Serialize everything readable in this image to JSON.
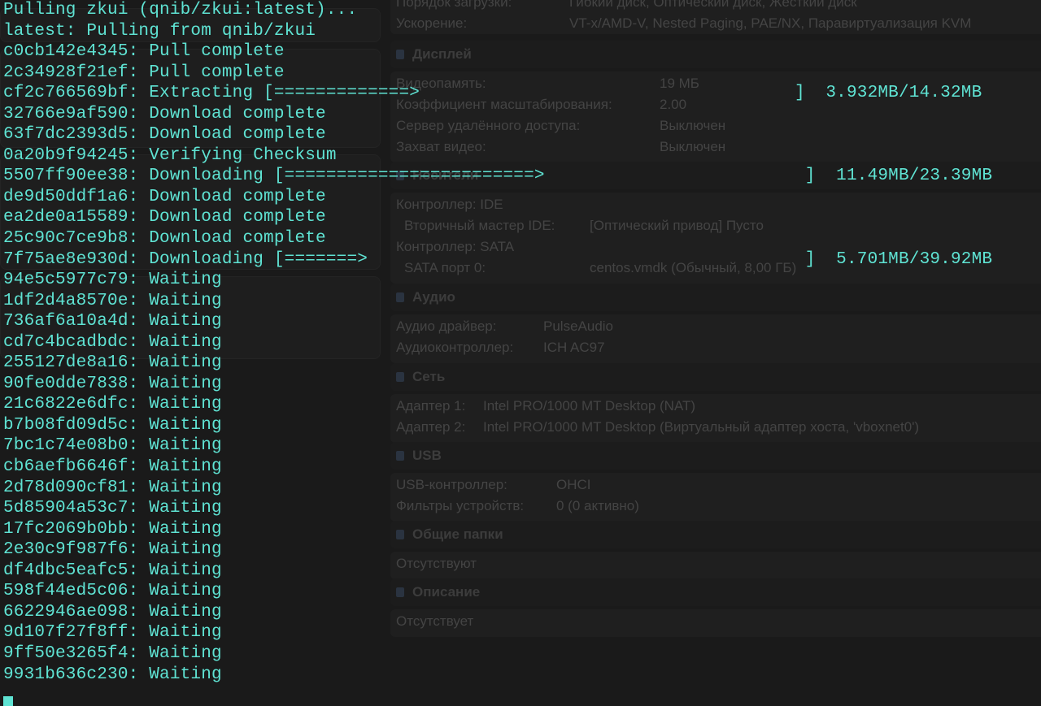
{
  "vbox_details": {
    "top_rows": [
      {
        "label": "Порядок загрузки:",
        "value": "Гибкий диск, Оптический диск, Жесткий диск"
      },
      {
        "label": "Ускорение:",
        "value": "VT-x/AMD-V, Nested Paging, PAE/NX, Паравиртуализация KVM"
      }
    ],
    "sections": [
      {
        "title": "Дисплей",
        "icon": "display-icon",
        "rows": [
          {
            "label": "Видеопамять:",
            "value": "19 МБ"
          },
          {
            "label": "Коэффициент масштабирования:",
            "value": "2.00"
          },
          {
            "label": "Сервер удалённого доступа:",
            "value": "Выключен"
          },
          {
            "label": "Захват видео:",
            "value": "Выключен"
          }
        ]
      },
      {
        "title": "Носители",
        "icon": "storage-icon",
        "rows": [
          {
            "label": "Контроллер: IDE",
            "value": ""
          },
          {
            "label": "Вторичный мастер IDE:",
            "value": "[Оптический привод] Пусто"
          },
          {
            "label": "Контроллер: SATA",
            "value": ""
          },
          {
            "label": "SATA порт 0:",
            "value": "centos.vmdk (Обычный, 8,00 ГБ)"
          }
        ]
      },
      {
        "title": "Аудио",
        "icon": "audio-icon",
        "rows": [
          {
            "label": "Аудио драйвер:",
            "value": "PulseAudio"
          },
          {
            "label": "Аудиоконтроллер:",
            "value": "ICH AC97"
          }
        ]
      },
      {
        "title": "Сеть",
        "icon": "network-icon",
        "rows": [
          {
            "label": "Адаптер 1:",
            "value": "Intel PRO/1000 MT Desktop (NAT)"
          },
          {
            "label": "Адаптер 2:",
            "value": "Intel PRO/1000 MT Desktop (Виртуальный адаптер хоста, 'vboxnet0')"
          }
        ]
      },
      {
        "title": "USB",
        "icon": "usb-icon",
        "rows": [
          {
            "label": "USB-контроллер:",
            "value": "OHCI"
          },
          {
            "label": "Фильтры устройств:",
            "value": "0 (0 активно)"
          }
        ]
      },
      {
        "title": "Общие папки",
        "icon": "shared-folder-icon",
        "rows": [
          {
            "label": "Отсутствуют",
            "value": ""
          }
        ]
      },
      {
        "title": "Описание",
        "icon": "description-icon",
        "rows": [
          {
            "label": "Отсутствует",
            "value": ""
          }
        ]
      }
    ]
  },
  "terminal": {
    "lines": [
      "Pulling zkui (qnib/zkui:latest)...",
      "latest: Pulling from qnib/zkui",
      "c0cb142e4345: Pull complete",
      "2c34928f21ef: Pull complete",
      "cf2c766569bf: Extracting [=============>                                    ]  3.932MB/14.32MB",
      "32766e9af590: Download complete",
      "63f7dc2393d5: Download complete",
      "0a20b9f94245: Verifying Checksum",
      "5507ff90ee38: Downloading [========================>                         ]  11.49MB/23.39MB",
      "de9d50ddf1a6: Download complete",
      "ea2de0a15589: Download complete",
      "25c90c7ce9b8: Download complete",
      "7f75ae8e930d: Downloading [=======>                                          ]  5.701MB/39.92MB",
      "94e5c5977c79: Waiting",
      "1df2d4a8570e: Waiting",
      "736af6a10a4d: Waiting",
      "cd7c4bcadbdc: Waiting",
      "255127de8a16: Waiting",
      "90fe0dde7838: Waiting",
      "21c6822e6dfc: Waiting",
      "b7b08fd09d5c: Waiting",
      "7bc1c74e08b0: Waiting",
      "cb6aefb6646f: Waiting",
      "2d78d090cf81: Waiting",
      "5d85904a53c7: Waiting",
      "17fc2069b0bb: Waiting",
      "2e30c9f987f6: Waiting",
      "df4dbc5eafc5: Waiting",
      "598f44ed5c06: Waiting",
      "6622946ae098: Waiting",
      "9d107f27f8ff: Waiting",
      "9ff50e3265f4: Waiting",
      "9931b636c230: Waiting"
    ],
    "progress": [
      {
        "layer": "cf2c766569bf",
        "fraction": 0.275
      },
      {
        "layer": "5507ff90ee38",
        "fraction": 0.491
      },
      {
        "layer": "7f75ae8e930d",
        "fraction": 0.143
      }
    ],
    "color": "#5fe3d3"
  }
}
